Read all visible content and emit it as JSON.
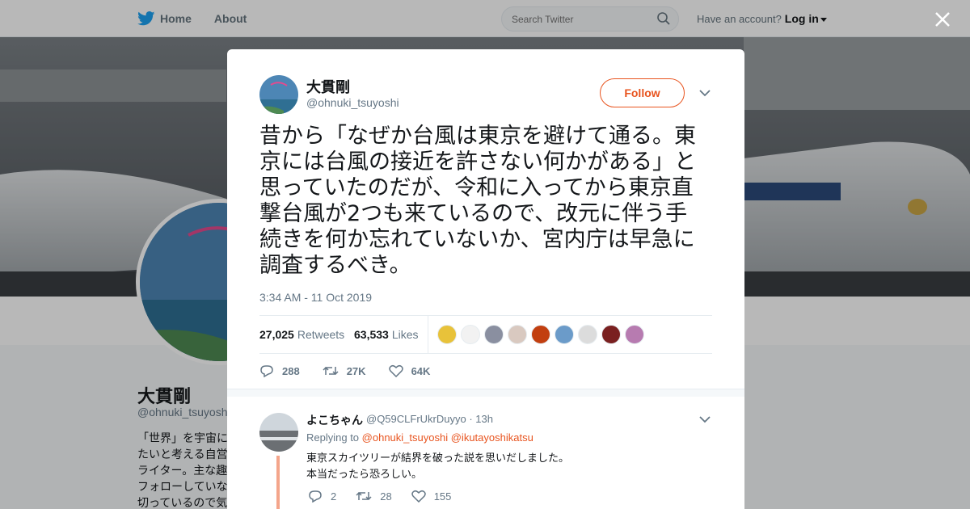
{
  "nav": {
    "home": "Home",
    "about": "About",
    "search_placeholder": "Search Twitter",
    "have_account": "Have an account?",
    "login": "Log in"
  },
  "background_profile": {
    "name": "大貫剛",
    "handle": "@ohnuki_tsuyoshi",
    "bio_lines": [
      "「世界」を宇宙に",
      "たいと考える自営",
      "ライター。主な趣",
      "フォローしていな",
      "切っているので気"
    ]
  },
  "tweet": {
    "author_name": "大貫剛",
    "author_handle": "@ohnuki_tsuyoshi",
    "follow_label": "Follow",
    "text_lines": [
      "昔から「なぜか台風は東京を避けて通る。東",
      "京には台風の接近を許さない何かがある」と",
      "思っていたのだが、令和に入ってから東京直",
      "撃台風が2つも来ているので、改元に伴う手",
      "続きを何か忘れていないか、宮内庁は早急に",
      "調査するべき。"
    ],
    "timestamp": "3:34 AM - 11 Oct 2019",
    "retweets_count": "27,025",
    "retweets_label": "Retweets",
    "likes_count": "63,533",
    "likes_label": "Likes",
    "reply_count": "288",
    "retweet_count_short": "27K",
    "like_count_short": "64K"
  },
  "reply": {
    "name": "よこちゃん",
    "meta": "@Q59CLFrUkrDuyyo · 13h",
    "replying_to": "Replying to",
    "mention1": "@ohnuki_tsuyoshi",
    "mention2": "@ikutayoshikatsu",
    "text_line1": "東京スカイツリーが結界を破った説を思いだしました。",
    "text_line2": "本当だったら恐ろしい。",
    "reply_count": "2",
    "retweet_count": "28",
    "like_count": "155"
  },
  "colors": {
    "accent": "#e8541f",
    "twitter_blue": "#1da1f2",
    "text_secondary": "#657786"
  }
}
